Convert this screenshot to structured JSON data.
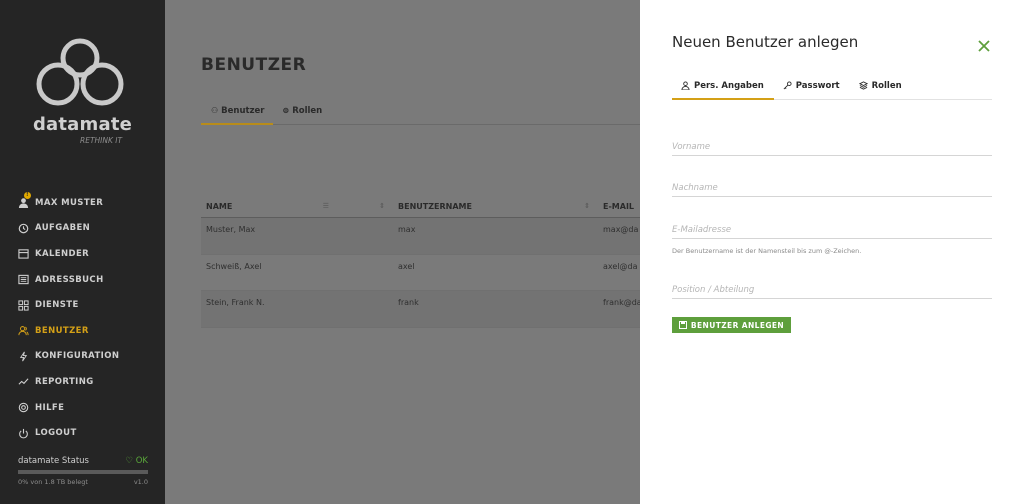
{
  "sidebar": {
    "brand_name": "datamate",
    "brand_tagline": "RETHINK IT",
    "nav": [
      {
        "label": "MAX MUSTER",
        "icon": "user-avatar-icon"
      },
      {
        "label": "AUFGABEN",
        "icon": "clock-icon"
      },
      {
        "label": "KALENDER",
        "icon": "calendar-icon"
      },
      {
        "label": "ADRESSBUCH",
        "icon": "addressbook-icon"
      },
      {
        "label": "DIENSTE",
        "icon": "grid-icon"
      },
      {
        "label": "BENUTZER",
        "icon": "users-icon"
      },
      {
        "label": "KONFIGURATION",
        "icon": "bolt-icon"
      },
      {
        "label": "REPORTING",
        "icon": "chart-icon"
      },
      {
        "label": "HILFE",
        "icon": "lifebuoy-icon"
      },
      {
        "label": "LOGOUT",
        "icon": "power-icon"
      }
    ],
    "active_index": 5,
    "status_label": "datamate Status",
    "status_value": "OK",
    "storage_text": "0% von 1.8 TB belegt",
    "version": "v1.0",
    "storage_fraction": 0.0
  },
  "main": {
    "title": "BENUTZER",
    "tabs": [
      {
        "label": "Benutzer",
        "icon": "users-icon"
      },
      {
        "label": "Rollen",
        "icon": "layers-icon"
      }
    ],
    "table": {
      "headers": [
        "NAME",
        "BENUTZERNAME",
        "E-MAIL"
      ],
      "rows": [
        [
          "Muster, Max",
          "max",
          "max@da"
        ],
        [
          "Schweiß, Axel",
          "axel",
          "axel@da"
        ],
        [
          "Stein, Frank N.",
          "frank",
          "frank@da"
        ]
      ]
    }
  },
  "panel": {
    "title": "Neuen Benutzer anlegen",
    "tabs": [
      {
        "label": "Pers. Angaben",
        "icon": "user-icon"
      },
      {
        "label": "Passwort",
        "icon": "key-icon"
      },
      {
        "label": "Rollen",
        "icon": "layers-icon"
      }
    ],
    "fields": {
      "first_name_placeholder": "Vorname",
      "last_name_placeholder": "Nachname",
      "email_placeholder": "E-Mailadresse",
      "position_placeholder": "Position / Abteilung"
    },
    "hint": "Der Benutzername ist der Namensteil bis zum @-Zeichen.",
    "submit_label": "BENUTZER ANLEGEN",
    "colors": {
      "accent": "#d4a017",
      "primary": "#5e9f3c",
      "close": "#5e9f3c"
    }
  }
}
